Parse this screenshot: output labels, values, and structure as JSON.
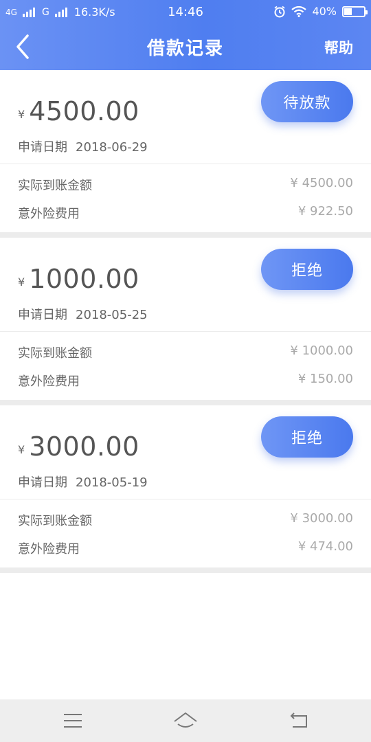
{
  "status_bar": {
    "net1": "4G",
    "net2": "G",
    "speed": "16.3K/s",
    "time": "14:46",
    "battery": "40%",
    "battery_level": 0.4
  },
  "header": {
    "title": "借款记录",
    "help_label": "帮助"
  },
  "records": [
    {
      "currency": "¥",
      "amount": "4500.00",
      "status": "待放款",
      "date_label": "申请日期",
      "date": "2018-06-29",
      "received_label": "实际到账金额",
      "received": "¥ 4500.00",
      "insurance_label": "意外险费用",
      "insurance": "¥ 922.50"
    },
    {
      "currency": "¥",
      "amount": "1000.00",
      "status": "拒绝",
      "date_label": "申请日期",
      "date": "2018-05-25",
      "received_label": "实际到账金额",
      "received": "¥ 1000.00",
      "insurance_label": "意外险费用",
      "insurance": "¥ 150.00"
    },
    {
      "currency": "¥",
      "amount": "3000.00",
      "status": "拒绝",
      "date_label": "申请日期",
      "date": "2018-05-19",
      "received_label": "实际到账金额",
      "received": "¥ 3000.00",
      "insurance_label": "意外险费用",
      "insurance": "¥ 474.00"
    }
  ],
  "colors": {
    "accent": "#4f7ef0",
    "accent_light": "#6f96f5",
    "separator": "#ececec",
    "nav_bg": "#eeeeee"
  }
}
